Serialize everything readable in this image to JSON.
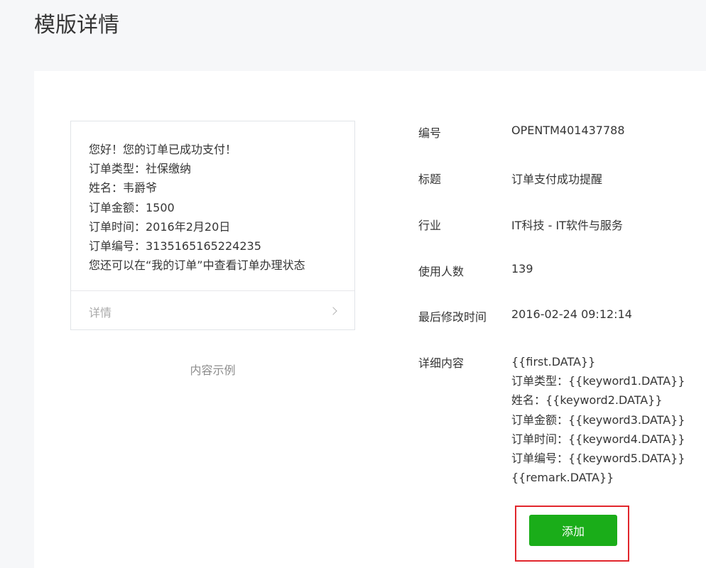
{
  "page": {
    "title": "模版详情"
  },
  "preview": {
    "lines": [
      "您好！您的订单已成功支付！",
      "订单类型：社保缴纳",
      "姓名：韦爵爷",
      "订单金额：1500",
      "订单时间：2016年2月20日",
      "订单编号：3135165165224235",
      "您还可以在“我的订单”中查看订单办理状态"
    ],
    "footer_label": "详情",
    "footer_icon": "chevron-right-icon",
    "caption": "内容示例"
  },
  "info": {
    "number_label": "编号",
    "number_value": "OPENTM401437788",
    "title_label": "标题",
    "title_value": "订单支付成功提醒",
    "industry_label": "行业",
    "industry_value": "IT科技 - IT软件与服务",
    "users_label": "使用人数",
    "users_value": "139",
    "modified_label": "最后修改时间",
    "modified_value": "2016-02-24 09:12:14",
    "content_label": "详细内容",
    "content_lines": [
      "{{first.DATA}}",
      "订单类型：{{keyword1.DATA}}",
      "姓名：{{keyword2.DATA}}",
      "订单金额：{{keyword3.DATA}}",
      "订单时间：{{keyword4.DATA}}",
      "订单编号：{{keyword5.DATA}}",
      "{{remark.DATA}}"
    ]
  },
  "actions": {
    "add_label": "添加"
  },
  "colors": {
    "primary_button": "#1aad19",
    "highlight_border": "#e1262c",
    "page_background": "#f6f7f9"
  }
}
